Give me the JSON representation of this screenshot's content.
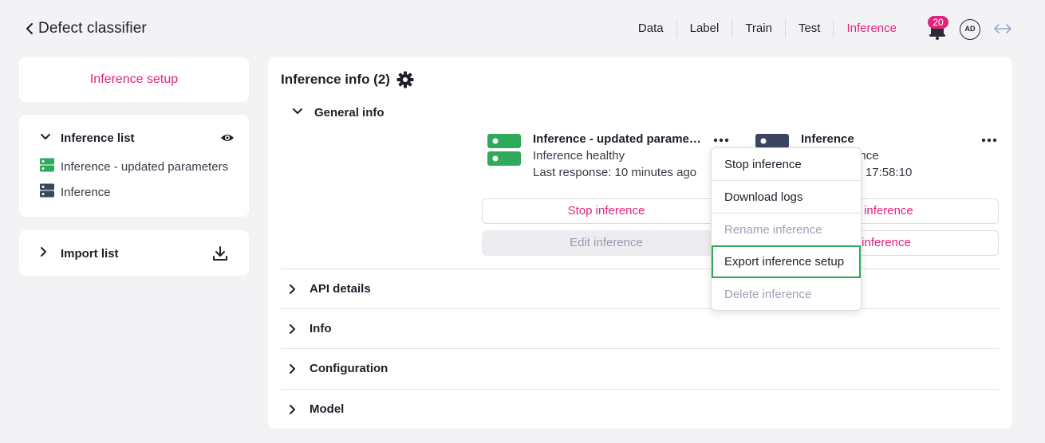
{
  "header": {
    "title": "Defect classifier",
    "tabs": [
      {
        "label": "Data",
        "active": false
      },
      {
        "label": "Label",
        "active": false
      },
      {
        "label": "Train",
        "active": false
      },
      {
        "label": "Test",
        "active": false
      },
      {
        "label": "Inference",
        "active": true
      }
    ],
    "notification_count": "20",
    "avatar_initials": "AD"
  },
  "sidebar": {
    "setup_label": "Inference setup",
    "inference_list": {
      "title": "Inference list",
      "items": [
        {
          "label": "Inference - updated parameters",
          "icon": "server-icon-green"
        },
        {
          "label": "Inference",
          "icon": "server-icon-dark"
        }
      ]
    },
    "import_list": {
      "title": "Import list"
    }
  },
  "main": {
    "title": "Inference info (2)",
    "general_info": "General info",
    "inferences": [
      {
        "name": "Inference - updated parameters",
        "status": "Inference healthy",
        "detail": "Last response: 10 minutes ago",
        "primary_button": "Stop inference",
        "secondary_button": "Edit inference",
        "icon_color": "#2eaa5a"
      },
      {
        "name": "Inference",
        "status": "Start inference",
        "detail": "2024-07-18 17:58:10",
        "primary_button": "Start inference",
        "secondary_button": "Edit inference",
        "icon_color": "#3b4461"
      }
    ],
    "sections": [
      "API details",
      "Info",
      "Configuration",
      "Model"
    ]
  },
  "menu": {
    "items": [
      {
        "label": "Stop inference",
        "disabled": false
      },
      {
        "label": "Download logs",
        "disabled": false
      },
      {
        "label": "Rename inference",
        "disabled": true
      },
      {
        "label": "Export inference setup",
        "disabled": false,
        "highlighted": true
      },
      {
        "label": "Delete inference",
        "disabled": true
      }
    ]
  },
  "colors": {
    "accent": "#e0247c",
    "success": "#2eaa5a",
    "server_dark": "#3b4461",
    "background": "#f3f3f5"
  }
}
